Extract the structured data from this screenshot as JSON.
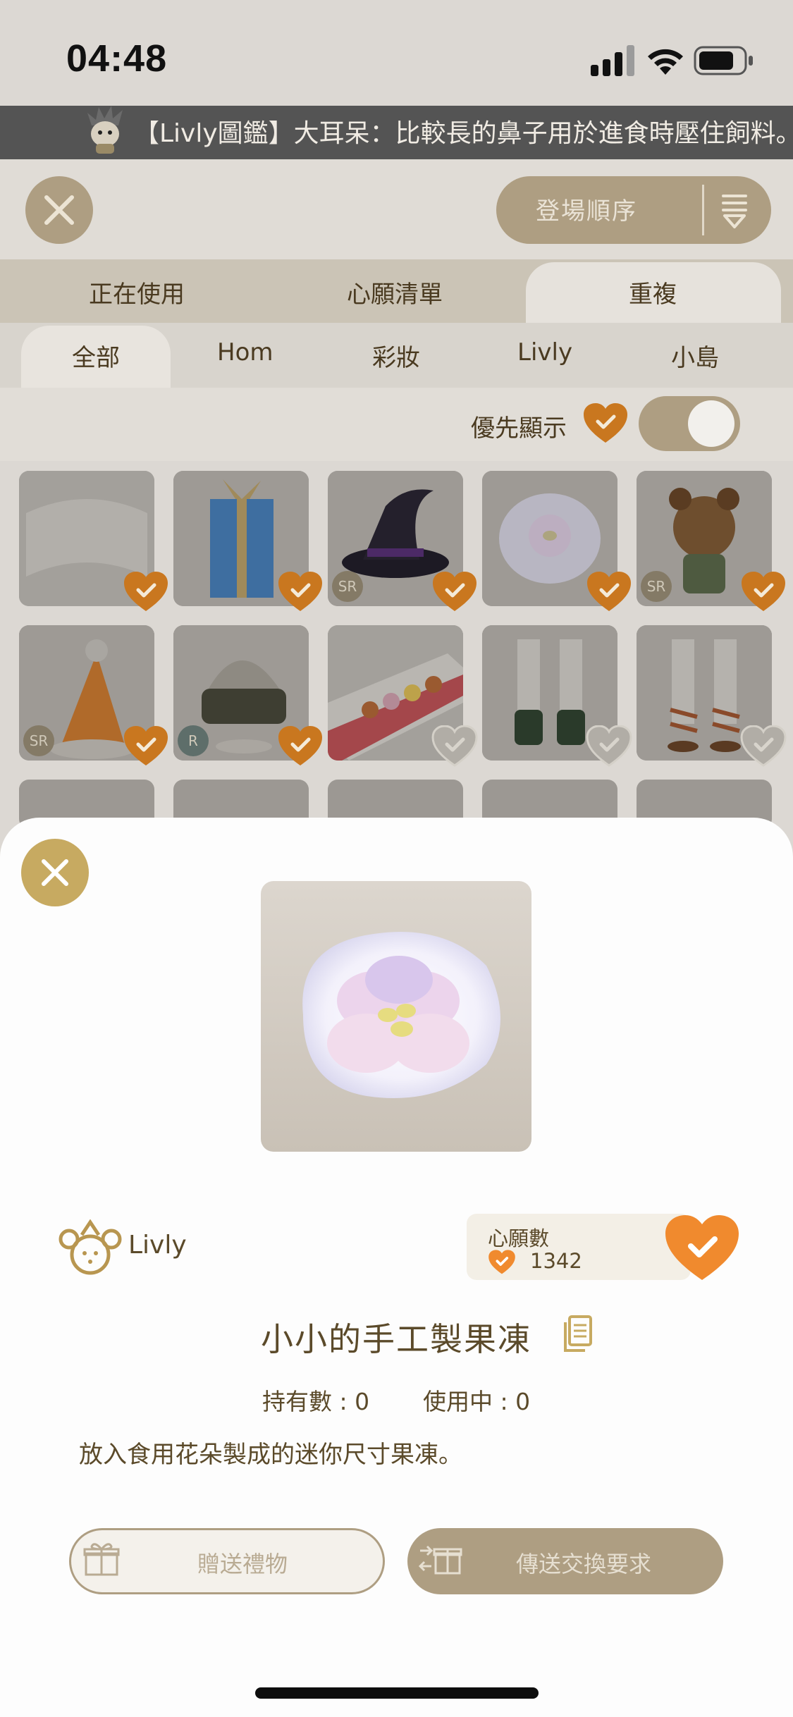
{
  "status": {
    "time": "04:48"
  },
  "ticker": {
    "text": "【Livly圖鑑】大耳呆：比較長的鼻子用於進食時壓住飼料。"
  },
  "header": {
    "sort_label": "登場順序"
  },
  "tabs_primary": [
    {
      "label": "正在使用",
      "active": false
    },
    {
      "label": "心願清單",
      "active": false
    },
    {
      "label": "重複",
      "active": true
    }
  ],
  "tabs_secondary": [
    {
      "label": "全部",
      "active": true
    },
    {
      "label": "Hom",
      "active": false
    },
    {
      "label": "彩妝",
      "active": false
    },
    {
      "label": "Livly",
      "active": false
    },
    {
      "label": "小島",
      "active": false
    }
  ],
  "filter": {
    "label": "優先顯示",
    "toggle_on": true
  },
  "grid_rarities": [
    "SR",
    "SR",
    "SR",
    "R"
  ],
  "sheet": {
    "brand": "Livly",
    "wish_title": "心願數",
    "wish_count": "1342",
    "item_name": "小小的手工製果凍",
    "owned": "持有數 : 0",
    "in_use": "使用中 : 0",
    "description": "放入食用花朵製成的迷你尺寸果凍。",
    "gift_button": "贈送禮物",
    "trade_button": "傳送交換要求"
  },
  "colors": {
    "accent_gold": "#c7aa61",
    "heart_orange": "#f08a2e",
    "text_brown": "#5b4a2a"
  }
}
